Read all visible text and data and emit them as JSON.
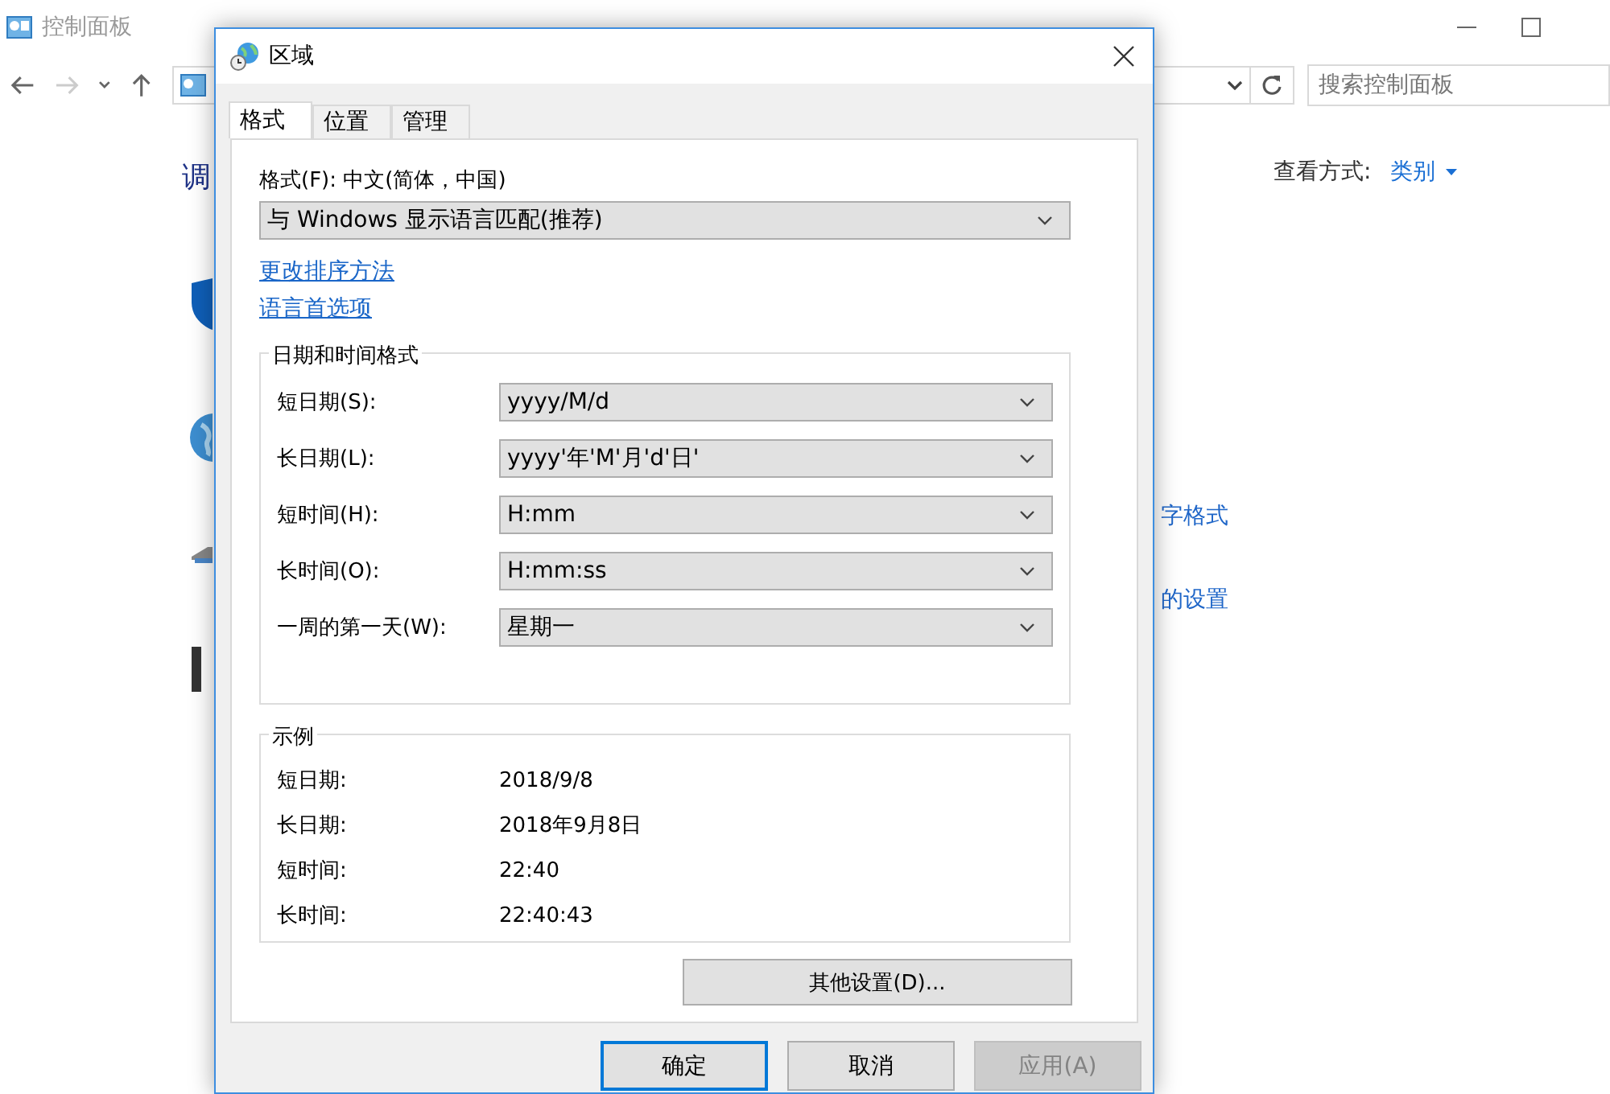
{
  "background_window": {
    "title": "控制面板",
    "search": {
      "placeholder": "搜索控制面板"
    },
    "heading": "调",
    "view_by_label": "查看方式:",
    "view_by_value": "类别",
    "links": [
      "字格式",
      "的设置"
    ]
  },
  "dialog": {
    "title": "区域",
    "tabs": [
      {
        "label": "格式",
        "selected": true
      },
      {
        "label": "位置",
        "selected": false
      },
      {
        "label": "管理",
        "selected": false
      }
    ],
    "format_label": "格式(F): 中文(简体，中国)",
    "format_combo": "与 Windows 显示语言匹配(推荐)",
    "links": [
      "更改排序方法",
      "语言首选项"
    ],
    "datetime_group": {
      "title": "日期和时间格式",
      "fields": [
        {
          "label": "短日期(S):",
          "value": "yyyy/M/d"
        },
        {
          "label": "长日期(L):",
          "value": "yyyy'年'M'月'd'日'"
        },
        {
          "label": "短时间(H):",
          "value": "H:mm"
        },
        {
          "label": "长时间(O):",
          "value": "H:mm:ss"
        },
        {
          "label": "一周的第一天(W):",
          "value": "星期一"
        }
      ]
    },
    "example_group": {
      "title": "示例",
      "rows": [
        {
          "label": "短日期:",
          "value": "2018/9/8"
        },
        {
          "label": "长日期:",
          "value": "2018年9月8日"
        },
        {
          "label": "短时间:",
          "value": "22:40"
        },
        {
          "label": "长时间:",
          "value": "22:40:43"
        }
      ]
    },
    "more_button": "其他设置(D)...",
    "buttons": [
      {
        "label": "确定",
        "focused": true,
        "disabled": false
      },
      {
        "label": "取消",
        "focused": false,
        "disabled": false
      },
      {
        "label": "应用(A)",
        "focused": false,
        "disabled": true
      }
    ]
  }
}
